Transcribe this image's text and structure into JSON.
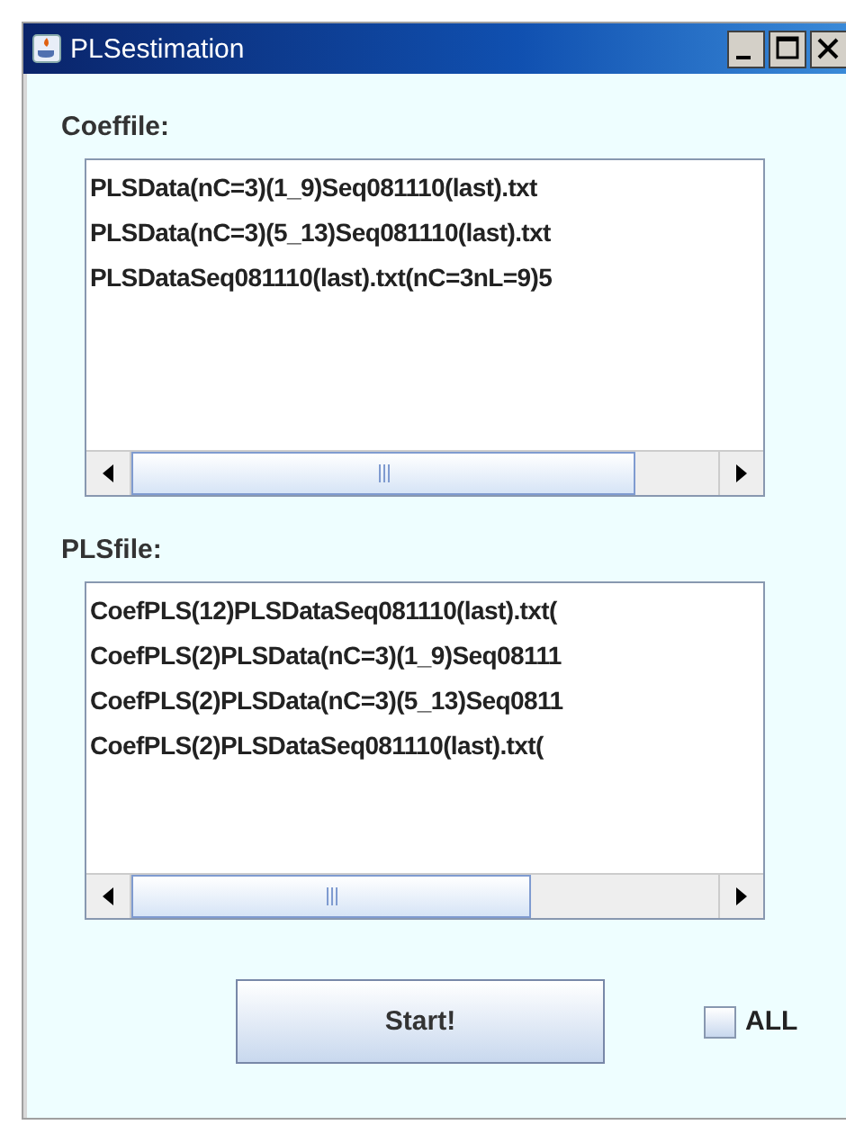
{
  "window": {
    "title": "PLSestimation"
  },
  "coeffile": {
    "label": "Coeffile:",
    "items": [
      "PLSData(nC=3)(1_9)Seq081110(last).txt",
      "PLSData(nC=3)(5_13)Seq081110(last).txt",
      "PLSDataSeq081110(last).txt(nC=3nL=9)5"
    ]
  },
  "plsfile": {
    "label": "PLSfile:",
    "items": [
      "CoefPLS(12)PLSDataSeq081110(last).txt(",
      "CoefPLS(2)PLSData(nC=3)(1_9)Seq08111",
      "CoefPLS(2)PLSData(nC=3)(5_13)Seq0811",
      "CoefPLS(2)PLSDataSeq081110(last).txt("
    ]
  },
  "start_button": {
    "label": "Start!"
  },
  "all_checkbox": {
    "label": "ALL",
    "checked": false
  }
}
